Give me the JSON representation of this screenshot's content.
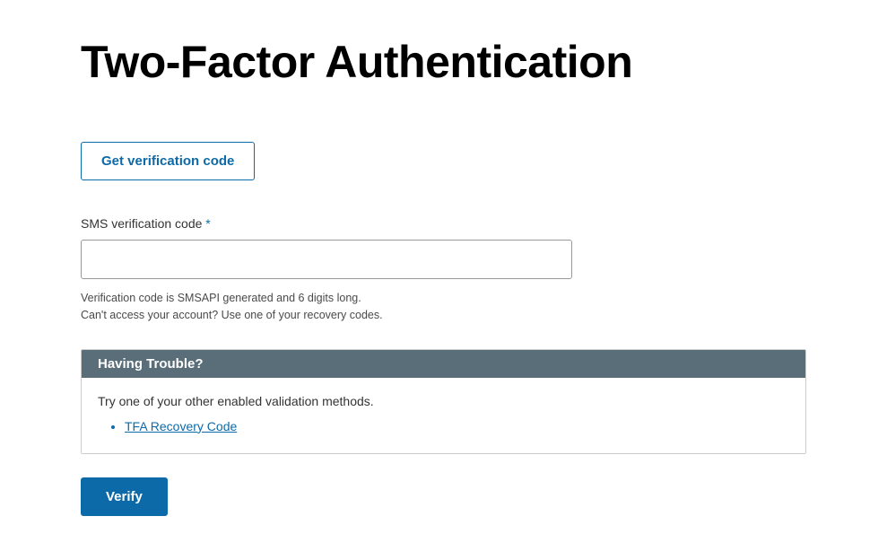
{
  "page": {
    "title": "Two-Factor Authentication"
  },
  "actions": {
    "get_code_label": "Get verification code",
    "verify_label": "Verify"
  },
  "form": {
    "code_label": "SMS verification code",
    "required_marker": "*",
    "code_value": "",
    "help_line1": "Verification code is SMSAPI generated and 6 digits long.",
    "help_line2": "Can't access your account? Use one of your recovery codes."
  },
  "trouble": {
    "title": "Having Trouble?",
    "text": "Try one of your other enabled validation methods.",
    "links": [
      {
        "label": "TFA Recovery Code"
      }
    ]
  }
}
